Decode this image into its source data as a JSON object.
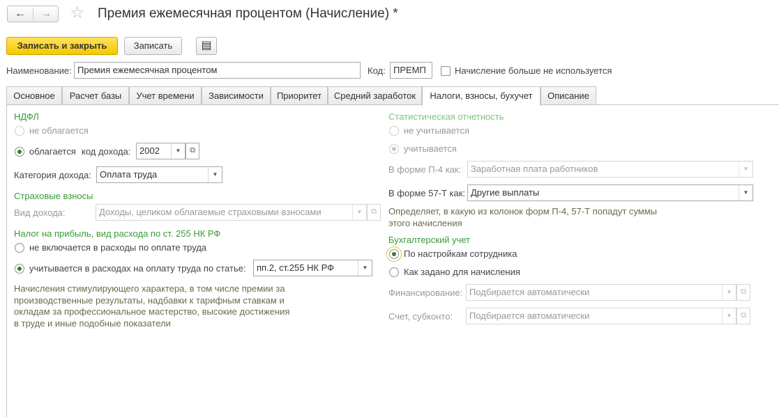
{
  "window": {
    "title": "Премия ежемесячная процентом (Начисление) *"
  },
  "nav": {
    "back": "←",
    "forward": "→",
    "favorite": "☆"
  },
  "toolbar": {
    "save_close": "Записать и закрыть",
    "save": "Записать",
    "report_icon": "▤"
  },
  "header": {
    "name_label": "Наименование:",
    "name_value": "Премия ежемесячная процентом",
    "code_label": "Код:",
    "code_value": "ПРЕМП",
    "unused_label": "Начисление больше не используется"
  },
  "tabs": [
    "Основное",
    "Расчет базы",
    "Учет времени",
    "Зависимости",
    "Приоритет",
    "Средний заработок",
    "Налоги, взносы, бухучет",
    "Описание"
  ],
  "left": {
    "ndfl_title": "НДФЛ",
    "ndfl_not_taxed": "не облагается",
    "ndfl_taxed": "облагается",
    "income_code_label": "код дохода:",
    "income_code_value": "2002",
    "income_category_label": "Категория дохода:",
    "income_category_value": "Оплата труда",
    "insurance_title": "Страховые взносы",
    "income_type_label": "Вид дохода:",
    "income_type_value": "Доходы, целиком облагаемые страховыми взносами",
    "profit_tax_title": "Налог на прибыль, вид расхода по ст. 255 НК РФ",
    "profit_not_included": "не включается в расходы по оплате труда",
    "profit_included": "учитывается в расходах на оплату труда по статье:",
    "profit_article_value": "пп.2, ст.255 НК РФ",
    "profit_note": "Начисления стимулирующего характера, в том числе премии за производственные результаты, надбавки к тарифным ставкам и окладам за профессиональное мастерство, высокие достижения в труде и иные подобные показатели"
  },
  "right": {
    "stat_title": "Статистическая отчетность",
    "stat_not_counted": "не учитывается",
    "stat_counted": "учитывается",
    "p4_label": "В форме П-4 как:",
    "p4_value": "Заработная плата работников",
    "t57_label": "В форме 57-Т как:",
    "t57_value": "Другие выплаты",
    "stat_note": "Определяет, в какую из колонок форм П-4, 57-Т попадут суммы этого начисления",
    "acc_title": "Бухгалтерский учет",
    "acc_by_employee": "По настройкам сотрудника",
    "acc_as_set": "Как задано для начисления",
    "financing_label": "Финансирование:",
    "financing_placeholder": "Подбирается автоматически",
    "account_label": "Счет, субконто:",
    "account_placeholder": "Подбирается автоматически"
  },
  "colors": {
    "section_green": "#3a9a3a",
    "primary_yellow": "#f5c800",
    "note_text": "#6b6b4b"
  }
}
